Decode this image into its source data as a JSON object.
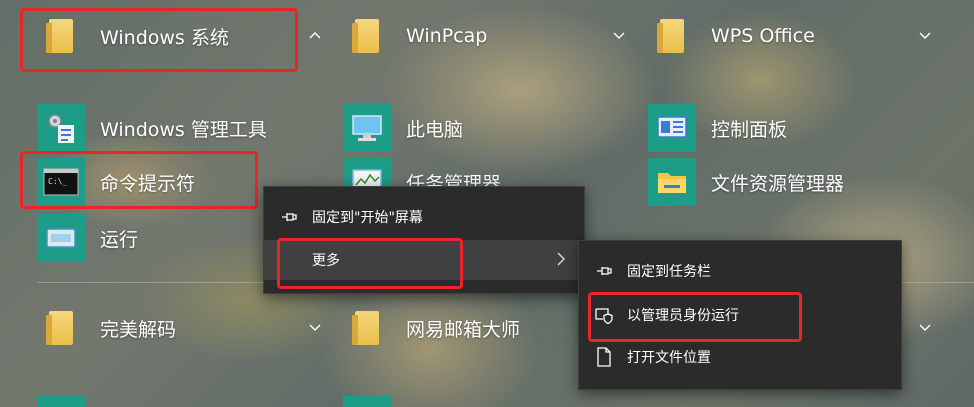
{
  "tiles": {
    "windows_system": "Windows 系统",
    "winpcap": "WinPcap",
    "wps_office": "WPS Office",
    "windows_admin_tools": "Windows 管理工具",
    "this_pc": "此电脑",
    "control_panel": "控制面板",
    "cmd": "命令提示符",
    "task_manager": "任务管理器",
    "file_explorer": "文件资源管理器",
    "run": "运行",
    "wanmei": "完美解码",
    "netease_mail": "网易邮箱大师"
  },
  "menu1": {
    "pin_start": "固定到\"开始\"屏幕",
    "more": "更多"
  },
  "menu2": {
    "pin_taskbar": "固定到任务栏",
    "run_admin": "以管理员身份运行",
    "open_location": "打开文件位置"
  },
  "icons": {
    "chevron_up": "chevron-up-icon",
    "chevron_down": "chevron-down-icon",
    "chevron_right": "chevron-right-icon"
  },
  "colors": {
    "tile_green": "#1d9d87",
    "highlight_red": "#e8262a",
    "menu_bg": "#2b2b2b",
    "menu_hover": "#404040"
  }
}
